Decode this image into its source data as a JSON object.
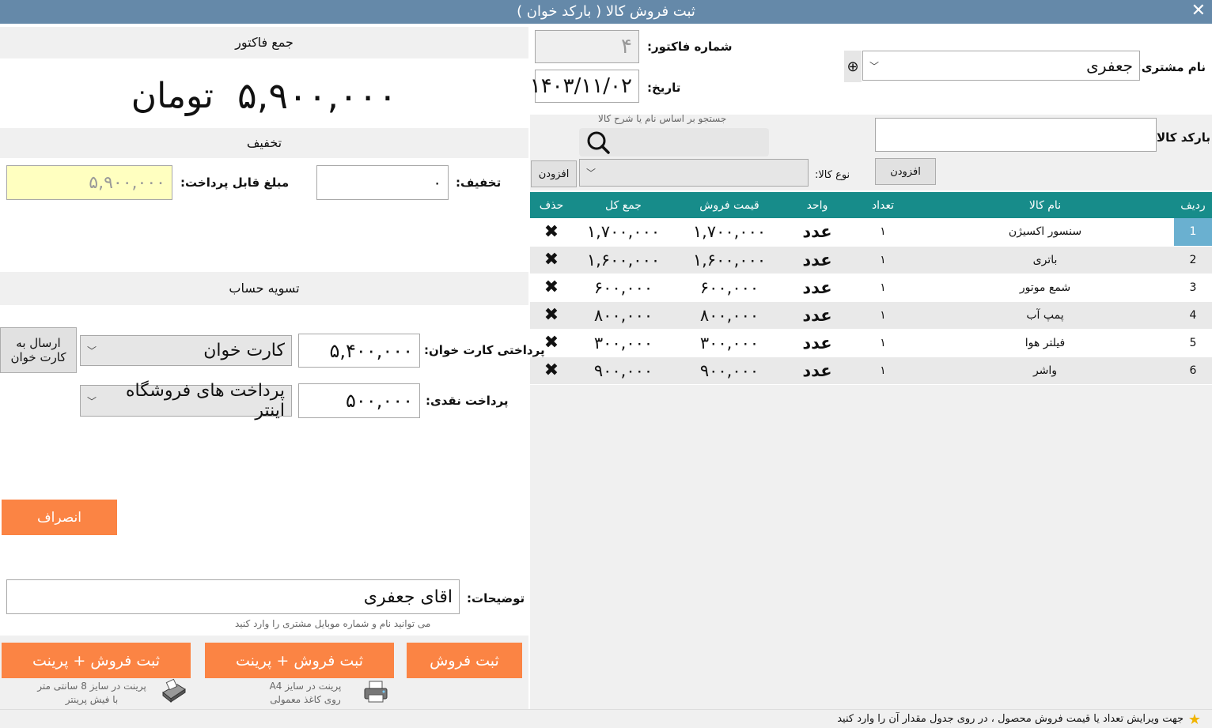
{
  "window": {
    "title": "ثبت فروش کالا ( بارکد خوان )",
    "close": "✕"
  },
  "customer": {
    "label": "نام مشتری:",
    "value": "جعفری",
    "add_icon": "⊕"
  },
  "invoice": {
    "number_label": "شماره فاکتور:",
    "number_value": "۴",
    "date_label": "تاریخ:",
    "date_value": "۱۴۰۳/۱۱/۰۲"
  },
  "search": {
    "hint": "جستجو بر اساس نام یا شرح کالا"
  },
  "barcode": {
    "label": "بارکد کالا:",
    "add_button": "افزودن"
  },
  "product_type": {
    "label": "نوع کالا:",
    "add_button": "افزودن"
  },
  "table": {
    "headers": [
      "ردیف",
      "نام کالا",
      "تعداد",
      "واحد",
      "قیمت فروش",
      "جمع کل",
      "حذف"
    ],
    "rows": [
      {
        "row": "1",
        "name": "سنسور اکسیژن",
        "qty": "۱",
        "unit": "عدد",
        "price": "۱,۷۰۰,۰۰۰",
        "total": "۱,۷۰۰,۰۰۰",
        "del": "✖"
      },
      {
        "row": "2",
        "name": "باتری",
        "qty": "۱",
        "unit": "عدد",
        "price": "۱,۶۰۰,۰۰۰",
        "total": "۱,۶۰۰,۰۰۰",
        "del": "✖"
      },
      {
        "row": "3",
        "name": "شمع موتور",
        "qty": "۱",
        "unit": "عدد",
        "price": "۶۰۰,۰۰۰",
        "total": "۶۰۰,۰۰۰",
        "del": "✖"
      },
      {
        "row": "4",
        "name": "پمپ آب",
        "qty": "۱",
        "unit": "عدد",
        "price": "۸۰۰,۰۰۰",
        "total": "۸۰۰,۰۰۰",
        "del": "✖"
      },
      {
        "row": "5",
        "name": "فیلتر هوا",
        "qty": "۱",
        "unit": "عدد",
        "price": "۳۰۰,۰۰۰",
        "total": "۳۰۰,۰۰۰",
        "del": "✖"
      },
      {
        "row": "6",
        "name": "واشر",
        "qty": "۱",
        "unit": "عدد",
        "price": "۹۰۰,۰۰۰",
        "total": "۹۰۰,۰۰۰",
        "del": "✖"
      }
    ]
  },
  "summary": {
    "title": "جمع فاکتور",
    "amount": "۵,۹۰۰,۰۰۰",
    "currency": "تومان"
  },
  "discount": {
    "title": "تخفیف",
    "label": "تخفیف:",
    "value": "۰",
    "payable_label": "مبلغ قابل پرداخت:",
    "payable_value": "۵,۹۰۰,۰۰۰"
  },
  "settlement": {
    "title": "تسویه حساب",
    "card_label": "پرداختی کارت خوان:",
    "card_value": "۵,۴۰۰,۰۰۰",
    "card_select": "کارت خوان",
    "send_button_l1": "ارسال به",
    "send_button_l2": "کارت خوان",
    "cash_label": "پرداخت نقدی:",
    "cash_value": "۵۰۰,۰۰۰",
    "cash_select": "پرداخت های فروشگاه اینتر"
  },
  "cancel_button": "انصراف",
  "notes": {
    "label": "توضیحات:",
    "value": "اقای جعفری",
    "hint": "می توانید نام و شماره موبایل مشتری را وارد کنید"
  },
  "actions": {
    "save": "ثبت فروش",
    "save_print_a4": "ثبت فروش + پرینت",
    "save_print_receipt": "ثبت فروش + پرینت",
    "a4_hint_l1": "پرینت در سایز A4",
    "a4_hint_l2": "روی کاغذ معمولی",
    "receipt_hint_l1": "پرینت در سایز 8 سانتی متر",
    "receipt_hint_l2": "با فیش پرینتر"
  },
  "status": {
    "text": "جهت ویرایش تعداد یا قیمت فروش محصول ، در روی جدول مقدار آن را وارد کنید",
    "icon": "★"
  }
}
